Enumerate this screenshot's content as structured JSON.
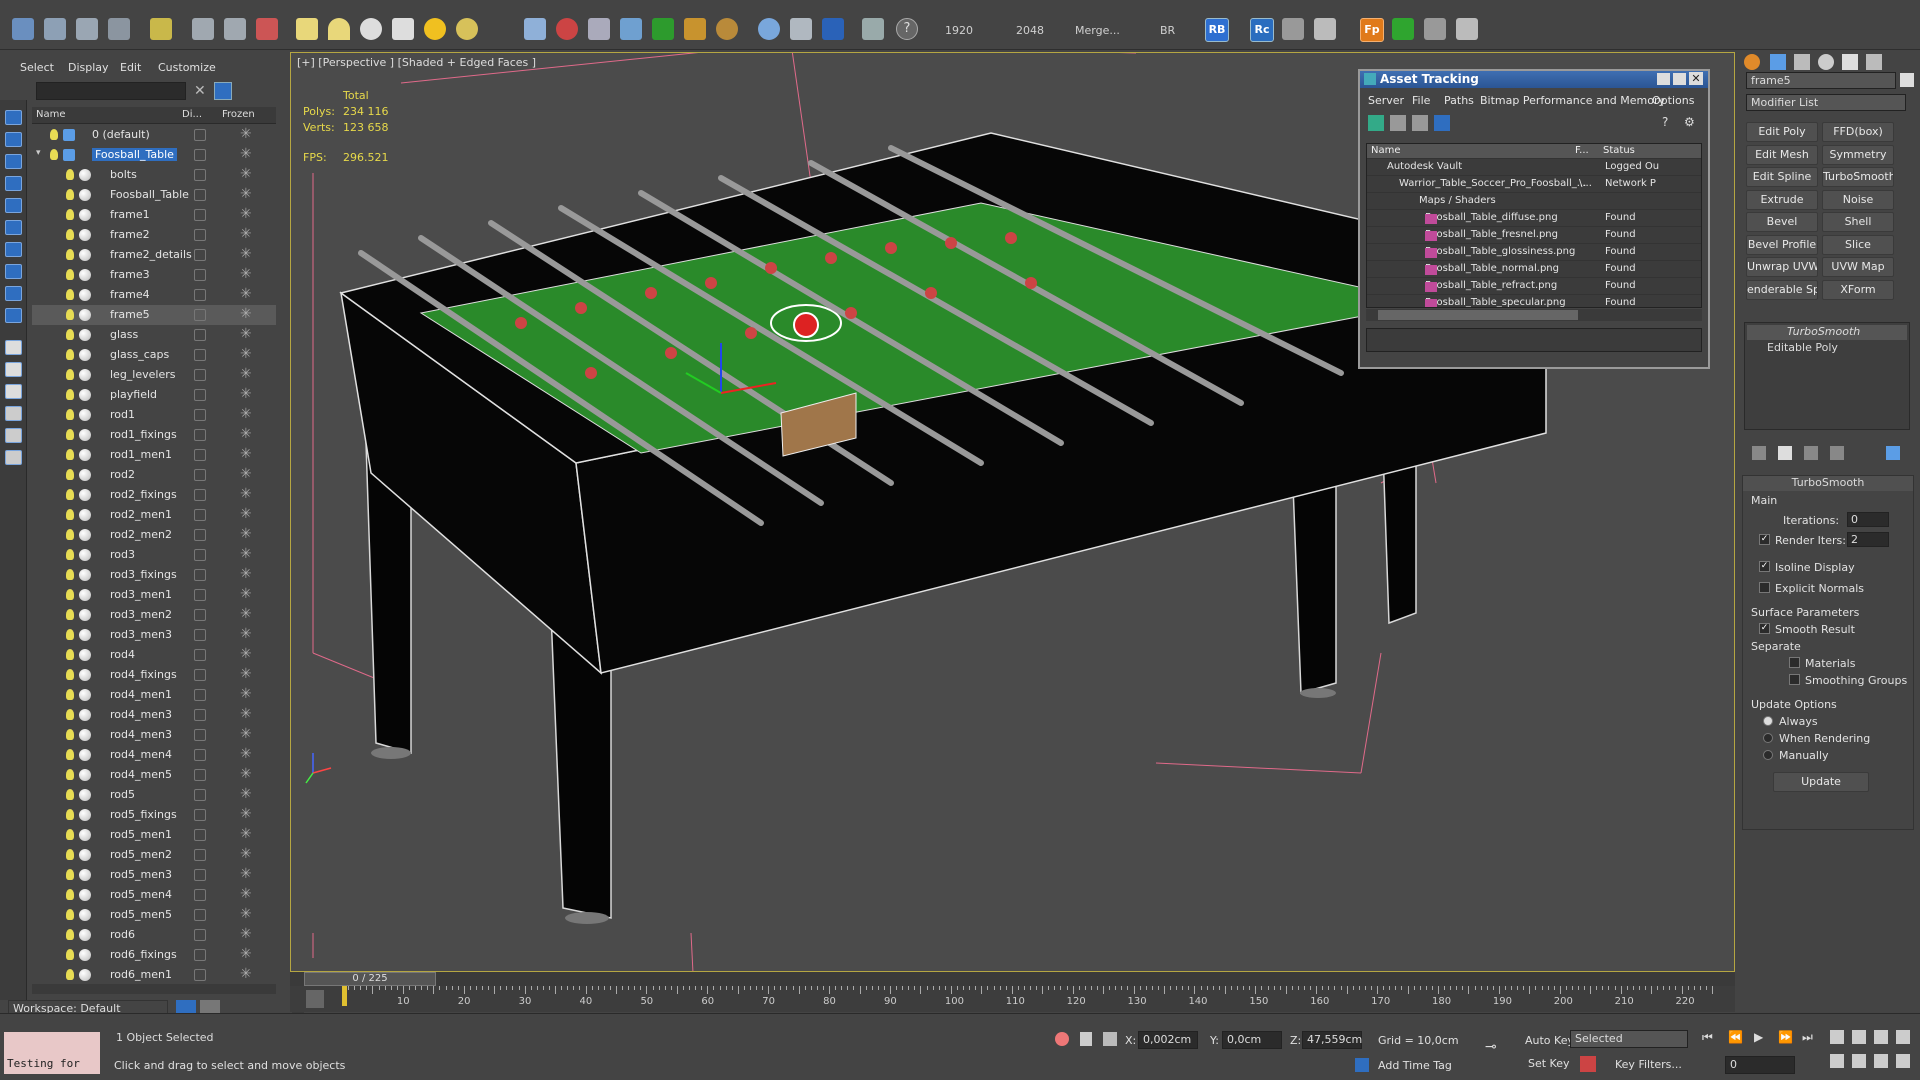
{
  "toolbar": {
    "render_width": "1920",
    "render_height": "2048",
    "merge_label": "Merge...",
    "br_label": "BR",
    "rb_label": "RB",
    "rc_label": "Rc",
    "fp_label": "Fp"
  },
  "explorer": {
    "menu": [
      "Select",
      "Display",
      "Edit",
      "Customize"
    ],
    "headers": {
      "name": "Name",
      "display": "Di...",
      "frozen": "Frozen"
    },
    "items": [
      {
        "name": "0 (default)",
        "type": "layer"
      },
      {
        "name": "Foosball_Table",
        "type": "layer",
        "selected": true
      },
      {
        "name": "bolts"
      },
      {
        "name": "Foosball_Table"
      },
      {
        "name": "frame1"
      },
      {
        "name": "frame2"
      },
      {
        "name": "frame2_details"
      },
      {
        "name": "frame3"
      },
      {
        "name": "frame4"
      },
      {
        "name": "frame5",
        "highlight": true
      },
      {
        "name": "glass"
      },
      {
        "name": "glass_caps"
      },
      {
        "name": "leg_levelers"
      },
      {
        "name": "playfield"
      },
      {
        "name": "rod1"
      },
      {
        "name": "rod1_fixings"
      },
      {
        "name": "rod1_men1"
      },
      {
        "name": "rod2"
      },
      {
        "name": "rod2_fixings"
      },
      {
        "name": "rod2_men1"
      },
      {
        "name": "rod2_men2"
      },
      {
        "name": "rod3"
      },
      {
        "name": "rod3_fixings"
      },
      {
        "name": "rod3_men1"
      },
      {
        "name": "rod3_men2"
      },
      {
        "name": "rod3_men3"
      },
      {
        "name": "rod4"
      },
      {
        "name": "rod4_fixings"
      },
      {
        "name": "rod4_men1"
      },
      {
        "name": "rod4_men3"
      },
      {
        "name": "rod4_men3"
      },
      {
        "name": "rod4_men4"
      },
      {
        "name": "rod4_men5"
      },
      {
        "name": "rod5"
      },
      {
        "name": "rod5_fixings"
      },
      {
        "name": "rod5_men1"
      },
      {
        "name": "rod5_men2"
      },
      {
        "name": "rod5_men3"
      },
      {
        "name": "rod5_men4"
      },
      {
        "name": "rod5_men5"
      },
      {
        "name": "rod6"
      },
      {
        "name": "rod6_fixings"
      },
      {
        "name": "rod6_men1"
      }
    ],
    "workspace": "Workspace: Default"
  },
  "viewport": {
    "label": "[+] [Perspective ] [Shaded + Edged Faces ]",
    "stats_total": "Total",
    "polys_label": "Polys:",
    "polys_value": "234 116",
    "verts_label": "Verts:",
    "verts_value": "123 658",
    "fps_label": "FPS:",
    "fps_value": "296.521"
  },
  "asset_tracking": {
    "title": "Asset Tracking",
    "menu": [
      "Server",
      "File",
      "Paths",
      "Bitmap Performance and Memory",
      "Options"
    ],
    "headers": {
      "name": "Name",
      "f": "F...",
      "status": "Status"
    },
    "rows": [
      {
        "name": "Autodesk Vault",
        "f": "",
        "status": "Logged Ou"
      },
      {
        "name": "Warrior_Table_Soccer_Pro_Foosball_...",
        "f": "\\...",
        "status": "Network P"
      },
      {
        "name": "Maps / Shaders",
        "f": "",
        "status": ""
      },
      {
        "name": "Foosball_Table_diffuse.png",
        "f": "",
        "status": "Found"
      },
      {
        "name": "Foosball_Table_fresnel.png",
        "f": "",
        "status": "Found"
      },
      {
        "name": "Foosball_Table_glossiness.png",
        "f": "",
        "status": "Found"
      },
      {
        "name": "Foosball_Table_normal.png",
        "f": "",
        "status": "Found"
      },
      {
        "name": "Foosball_Table_refract.png",
        "f": "",
        "status": "Found"
      },
      {
        "name": "Foosball_Table_specular.png",
        "f": "",
        "status": "Found"
      }
    ]
  },
  "command_panel": {
    "object_name": "frame5",
    "modifier_list": "Modifier List",
    "buttons": [
      "Edit Poly",
      "FFD(box)",
      "Edit Mesh",
      "Symmetry",
      "Edit Spline",
      "TurboSmooth",
      "Extrude",
      "Noise",
      "Bevel",
      "Shell",
      "Bevel Profile",
      "Slice",
      "Unwrap UVW",
      "UVW Map",
      "enderable Splin",
      "XForm"
    ],
    "stack": [
      "TurboSmooth",
      "Editable Poly"
    ],
    "rollout_title": "TurboSmooth",
    "main_label": "Main",
    "iterations_label": "Iterations:",
    "iterations_value": "0",
    "render_iters_label": "Render Iters:",
    "render_iters_value": "2",
    "isoline_label": "Isoline Display",
    "explicit_normals_label": "Explicit Normals",
    "surface_params_label": "Surface Parameters",
    "smooth_result_label": "Smooth Result",
    "separate_label": "Separate",
    "materials_label": "Materials",
    "smoothing_groups_label": "Smoothing Groups",
    "update_options_label": "Update Options",
    "always_label": "Always",
    "when_rendering_label": "When Rendering",
    "manually_label": "Manually",
    "update_button": "Update"
  },
  "timeline": {
    "frame_counter": "0 / 225",
    "ticks": [
      "10",
      "20",
      "30",
      "40",
      "50",
      "60",
      "70",
      "80",
      "90",
      "100",
      "110",
      "120",
      "130",
      "140",
      "150",
      "160",
      "170",
      "180",
      "190",
      "200",
      "210",
      "220"
    ]
  },
  "status": {
    "script_text": "Testing for",
    "selection": "1 Object Selected",
    "hint": "Click and drag to select and move objects",
    "x_label": "X:",
    "x_value": "0,002cm",
    "y_label": "Y:",
    "y_value": "0,0cm",
    "z_label": "Z:",
    "z_value": "47,559cm",
    "grid": "Grid = 10,0cm",
    "add_time_tag": "Add Time Tag",
    "auto_key": "Auto Key",
    "selected": "Selected",
    "set_key": "Set Key",
    "key_filters": "Key Filters...",
    "frame_value": "0"
  }
}
